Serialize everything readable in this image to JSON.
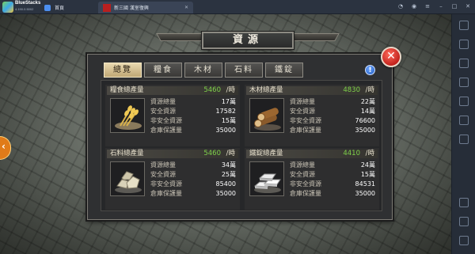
{
  "window": {
    "brand": "BlueStacks",
    "version": "4.190.0.5002",
    "tabs": [
      {
        "label": "首頁"
      },
      {
        "label": "新三國 漢室復興"
      }
    ]
  },
  "game": {
    "title": "資源",
    "tabs": [
      "總覽",
      "糧食",
      "木材",
      "石料",
      "鐵錠"
    ],
    "active_tab": "總覽",
    "cards": [
      {
        "name": "糧食總產量",
        "rate": "5460",
        "unit": "/時",
        "icon": "wheat-icon",
        "rows": [
          {
            "label": "資源總量",
            "value": "17萬"
          },
          {
            "label": "安全資源",
            "value": "17582"
          },
          {
            "label": "非安全資源",
            "value": "15萬"
          },
          {
            "label": "倉庫保護量",
            "value": "35000"
          }
        ]
      },
      {
        "name": "木材總產量",
        "rate": "4830",
        "unit": "/時",
        "icon": "log-icon",
        "rows": [
          {
            "label": "資源總量",
            "value": "22萬"
          },
          {
            "label": "安全資源",
            "value": "14萬"
          },
          {
            "label": "非安全資源",
            "value": "76600"
          },
          {
            "label": "倉庫保護量",
            "value": "35000"
          }
        ]
      },
      {
        "name": "石料總產量",
        "rate": "5460",
        "unit": "/時",
        "icon": "stone-icon",
        "rows": [
          {
            "label": "資源總量",
            "value": "34萬"
          },
          {
            "label": "安全資源",
            "value": "25萬"
          },
          {
            "label": "非安全資源",
            "value": "85400"
          },
          {
            "label": "倉庫保護量",
            "value": "35000"
          }
        ]
      },
      {
        "name": "鐵錠總產量",
        "rate": "4410",
        "unit": "/時",
        "icon": "iron-ingot-icon",
        "rows": [
          {
            "label": "資源總量",
            "value": "24萬"
          },
          {
            "label": "安全資源",
            "value": "15萬"
          },
          {
            "label": "非安全資源",
            "value": "84531"
          },
          {
            "label": "倉庫保護量",
            "value": "35000"
          }
        ]
      }
    ]
  },
  "colors": {
    "rate_green": "#7fd34a",
    "close_red": "#c2221d",
    "active_tab": "#e9d9b0"
  }
}
